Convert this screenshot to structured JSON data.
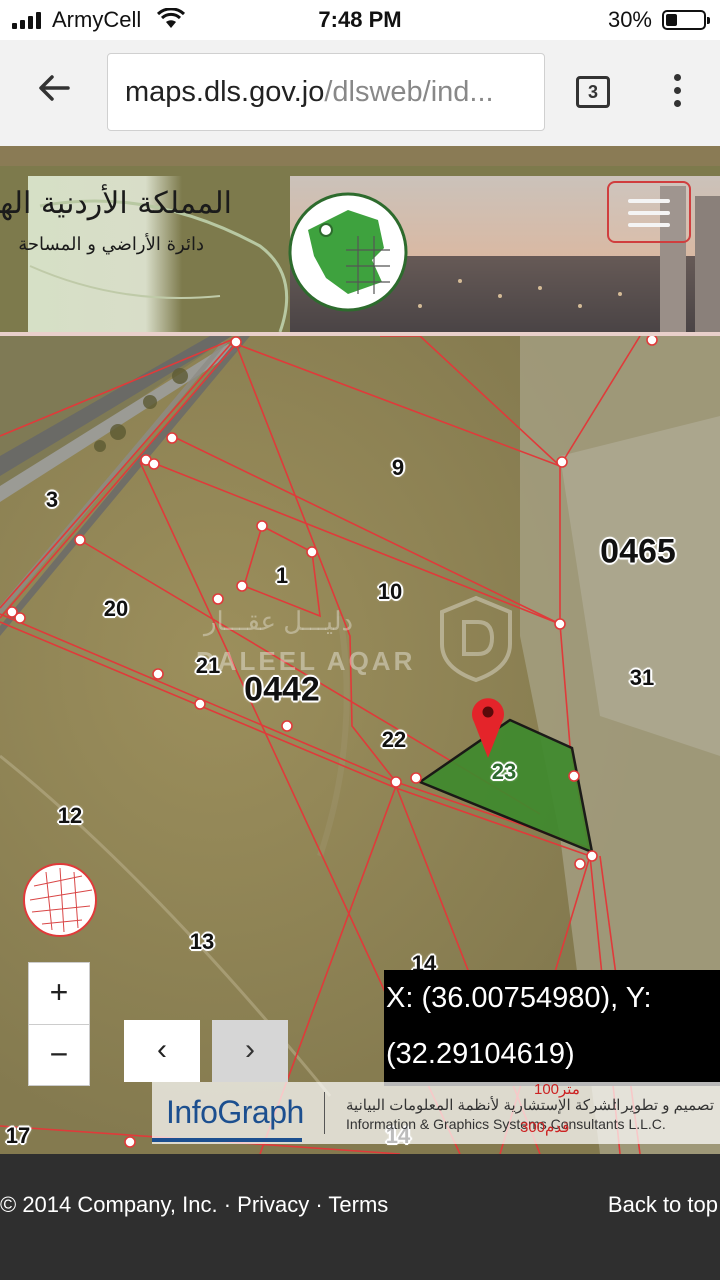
{
  "status_bar": {
    "carrier": "ArmyCell",
    "time": "7:48 PM",
    "battery_percent": "30%",
    "battery_level": 0.3
  },
  "browser": {
    "url_host": "maps.dls.gov.jo",
    "url_path": "/dlsweb/ind...",
    "tab_count": "3",
    "icons": [
      "back-arrow-icon",
      "tabs-icon",
      "overflow-menu-icon"
    ]
  },
  "site_header": {
    "title": "المملكة الأردنية الهاشمية",
    "subtitle": "دائرة الأراضي و المساحة",
    "logo_text": "دائرة الأراضي والمساحة"
  },
  "map": {
    "parcels": [
      {
        "label": "9"
      },
      {
        "label": "3"
      },
      {
        "label": "0465"
      },
      {
        "label": "1"
      },
      {
        "label": "10"
      },
      {
        "label": "20"
      },
      {
        "label": "21"
      },
      {
        "label": "0442"
      },
      {
        "label": "31"
      },
      {
        "label": "22"
      },
      {
        "label": "23"
      },
      {
        "label": "12"
      },
      {
        "label": "13"
      },
      {
        "label": "14"
      },
      {
        "label": "14"
      },
      {
        "label": "17"
      }
    ],
    "watermark_en": "DALEEL AQAR",
    "watermark_ar": "دليـــل عقـــار",
    "zoom_in": "+",
    "zoom_out": "−",
    "prev": "‹",
    "next": "›",
    "coord_line1": "X: (36.00754980), Y:",
    "coord_line2": "(32.29104619)",
    "scale_m": "100متر",
    "scale_ft": "300قدم",
    "credit_logo": "InfoGraph",
    "credit_company_ar": "الشركة الإستشارية لأنظمة المعلومات البيانية",
    "credit_company_en": "Information & Graphics Systems Consultants L.L.C.",
    "credit_design_ar": "تصميم و تطوير :",
    "selected_parcel_color": "#3f8a2e",
    "boundary_color": "#e03a3a"
  },
  "footer": {
    "copyright": "© 2014 Company, Inc. · ",
    "privacy": "Privacy",
    "dot": " · ",
    "terms": "Terms",
    "back_to_top": "Back to top"
  }
}
